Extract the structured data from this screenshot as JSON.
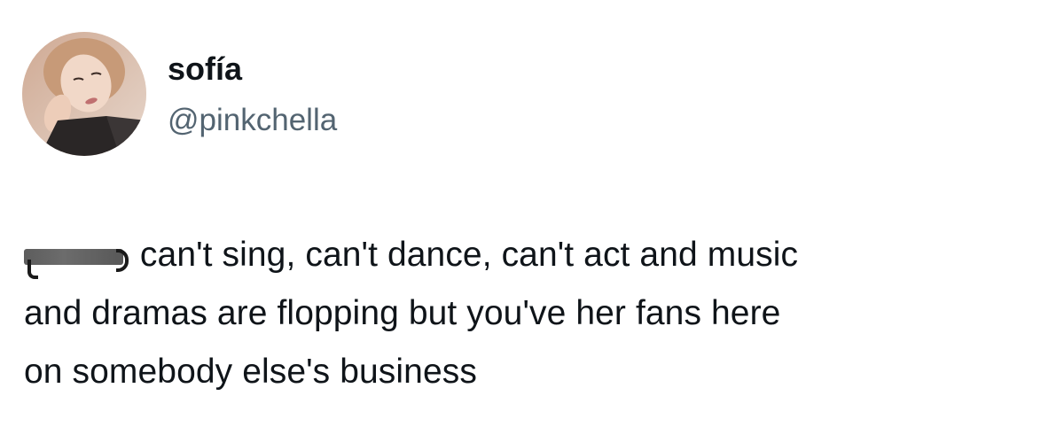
{
  "user": {
    "display_name": "sofía",
    "handle": "@pinkchella"
  },
  "tweet": {
    "line1_after_redaction": " can't sing, can't dance, can't act and music",
    "line2": "and dramas are flopping but you've her fans here",
    "line3": "on somebody else's business"
  },
  "colors": {
    "text_primary": "#0f1419",
    "text_secondary": "#536471",
    "background": "#ffffff",
    "redaction": "#636363"
  }
}
